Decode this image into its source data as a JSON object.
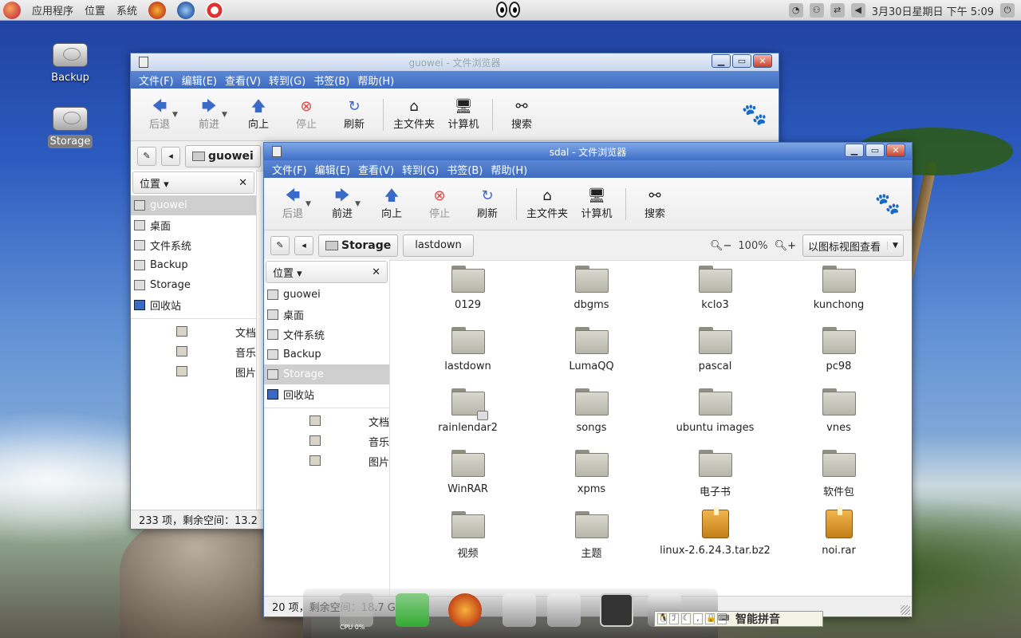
{
  "panel": {
    "menu": [
      "应用程序",
      "位置",
      "系统"
    ],
    "clock": "3月30日星期日 下午 5:09"
  },
  "desktop_icons": [
    {
      "label": "Backup"
    },
    {
      "label": "Storage"
    }
  ],
  "back_window": {
    "title": "guowei - 文件浏览器",
    "menus": [
      "文件(F)",
      "编辑(E)",
      "查看(V)",
      "转到(G)",
      "书签(B)",
      "帮助(H)"
    ],
    "toolbar": [
      "后退",
      "前进",
      "向上",
      "停止",
      "刷新",
      "主文件夹",
      "计算机",
      "搜索"
    ],
    "crumb": "guowei",
    "sidebar_header": "位置",
    "places": [
      "guowei",
      "桌面",
      "文件系统",
      "Backup",
      "Storage",
      "回收站"
    ],
    "bookmarks": [
      "文档",
      "音乐",
      "图片"
    ],
    "status": "233 项，剩余空间：13.2"
  },
  "front_window": {
    "title": "sdal - 文件浏览器",
    "menus": [
      "文件(F)",
      "编辑(E)",
      "查看(V)",
      "转到(G)",
      "书签(B)",
      "帮助(H)"
    ],
    "toolbar": [
      "后退",
      "前进",
      "向上",
      "停止",
      "刷新",
      "主文件夹",
      "计算机",
      "搜索"
    ],
    "crumbs": [
      "Storage",
      "lastdown"
    ],
    "zoom": "100%",
    "view_mode": "以图标视图查看",
    "sidebar_header": "位置",
    "places": [
      "guowei",
      "桌面",
      "文件系统",
      "Backup",
      "Storage",
      "回收站"
    ],
    "bookmarks": [
      "文档",
      "音乐",
      "图片"
    ],
    "files": [
      "0129",
      "dbgms",
      "kclo3",
      "kunchong",
      "lastdown",
      "LumaQQ",
      "pascal",
      "pc98",
      "rainlendar2",
      "songs",
      "ubuntu images",
      "vnes",
      "WinRAR",
      "xpms",
      "电子书",
      "软件包",
      "视频",
      "主题",
      "linux-2.6.24.3.tar.bz2",
      "noi.rar"
    ],
    "status": "20 项，剩余空间：18.7 GB"
  },
  "dock": {
    "cpu": "CPU 0%"
  },
  "ime": {
    "label": "智能拼音"
  }
}
